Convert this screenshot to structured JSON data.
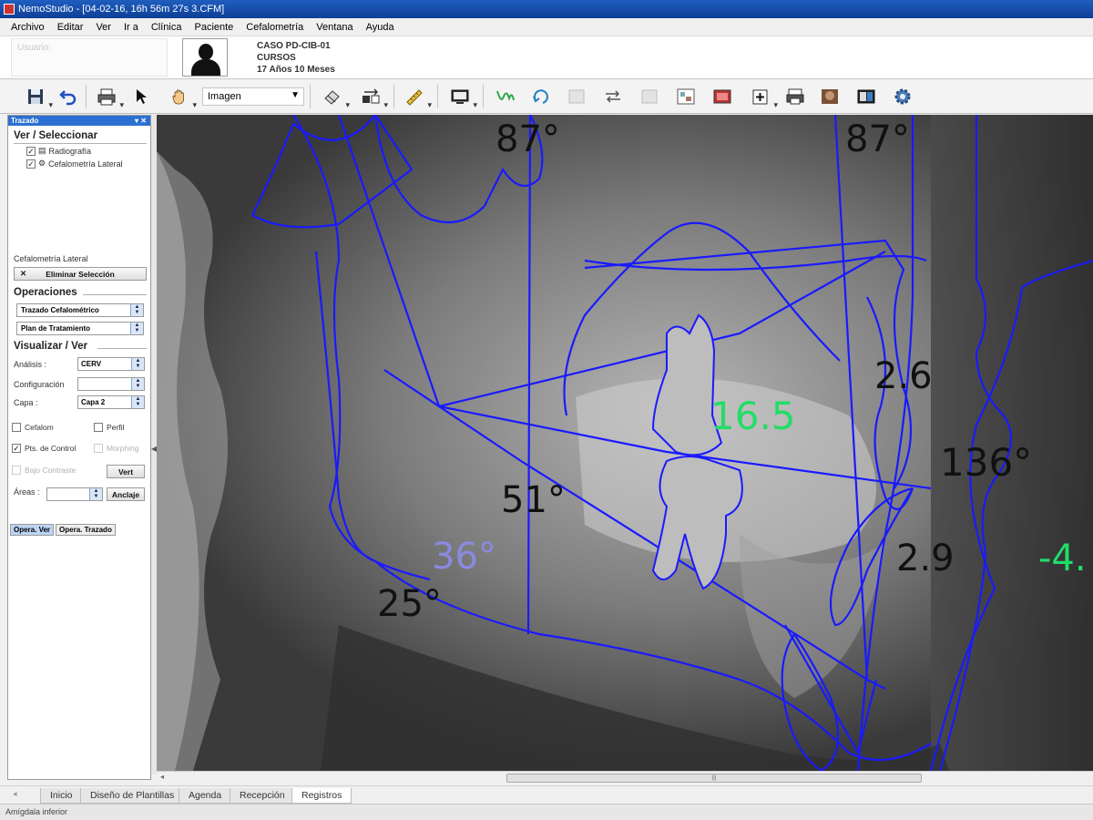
{
  "window": {
    "title": "NemoStudio - [04-02-16, 16h 56m 27s 3.CFM]"
  },
  "menu": [
    "Archivo",
    "Editar",
    "Ver",
    "Ir a",
    "Clínica",
    "Paciente",
    "Cefalometría",
    "Ventana",
    "Ayuda"
  ],
  "patient": {
    "user_placeholder": "Usuario:",
    "case": "CASO PD-CIB-01",
    "group": "CURSOS",
    "age": "17 Años 10 Meses"
  },
  "toolbar": {
    "image_select": "Imagen",
    "icons": [
      "save-icon",
      "undo-icon",
      "print-icon",
      "pointer-icon",
      "pan-hand-icon",
      "eraser-icon",
      "flip-icon",
      "ruler-icon",
      "monitor-icon",
      "tracing-icon",
      "rotate-icon",
      "grid-icon",
      "arrows-icon",
      "blank-icon",
      "image-icon",
      "photo-icon",
      "zoom-icon",
      "print-layout-icon",
      "face-photo-icon",
      "compare-icon",
      "settings-icon"
    ]
  },
  "sidebar": {
    "panel_title": "Trazado",
    "view_select_title": "Ver / Seleccionar",
    "tree": [
      "Radiografía",
      "Cefalometría Lateral"
    ],
    "ceph_label": "Cefalometría Lateral",
    "delete_selection": "Eliminar Selección",
    "operations_title": "Operaciones",
    "operations": [
      "Trazado Cefalométrico",
      "Plan de Tratamiento"
    ],
    "visualize_title": "Visualizar / Ver",
    "analysis_label": "Análisis :",
    "analysis_value": "CERV",
    "config_label": "Configuración",
    "config_value": "",
    "layer_label": "Capa :",
    "layer_value": "Capa 2",
    "cefalom": "Cefalom",
    "perfil": "Perfil",
    "control_points": "Pts. de Control",
    "morphing": "Morphing",
    "low_contrast": "Bajo Contraste",
    "vert": "Vert",
    "areas_label": "Áreas :",
    "anchor": "Anclaje",
    "tab_view": "Opera. Ver",
    "tab_trace": "Opera. Trazado"
  },
  "measurements": {
    "angle_top_left": "87°",
    "angle_top_right": "87°",
    "dist_upper_incisor": "2.6",
    "overjet": "16.5",
    "interincisal_angle": "136°",
    "angle_51": "51°",
    "dist_lower_incisor": "2.9",
    "lip_value": "-4.",
    "angle_36": "36°",
    "angle_25": "25°"
  },
  "bottom_tabs": [
    "Inicio",
    "Diseño de Plantillas",
    "Agenda",
    "Recepción",
    "Registros"
  ],
  "status": "Amígdala inferior",
  "colors": {
    "tracing": "#1a1aff",
    "green_value": "#22dd66",
    "lavender_value": "#8a8ae0",
    "titlebar": "#1f5ebf"
  }
}
